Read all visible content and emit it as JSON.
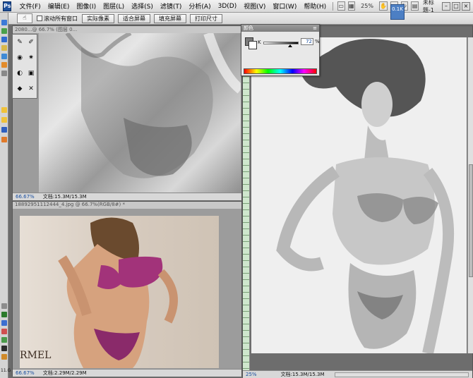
{
  "menubar": {
    "logo": "Ps",
    "items": [
      "文件(F)",
      "编辑(E)",
      "图像(I)",
      "图层(L)",
      "选择(S)",
      "滤镜(T)",
      "分析(A)",
      "3D(D)",
      "视图(V)",
      "窗口(W)",
      "帮助(H)"
    ],
    "zoom": "25%",
    "doc_title": "未标题-1"
  },
  "optbar": {
    "checkbox_label": "滚动所有窗口",
    "buttons": [
      "实际像素",
      "适合屏幕",
      "填充屏幕",
      "打印尺寸"
    ]
  },
  "tiny_overlay": {
    "text": "0.1K"
  },
  "color_panel": {
    "title": "颜色",
    "channel_label": "K",
    "value": "72",
    "unit": "%",
    "fg_color": "#7a7a7a",
    "bg_color": "#ffffff"
  },
  "doc1": {
    "title": "2080...@ 66.7% (图层 0...",
    "zoom": "66.67%",
    "size": "文档:15.3M/15.3M"
  },
  "doc2": {
    "title": "18892951112444_4.jpg @ 66.7%(RGB/8#) *",
    "zoom": "66.67%",
    "size": "文档:2.29M/2.29M",
    "watermark": "RMEL"
  },
  "doc3": {
    "zoom": "25%",
    "size": "文档:15.3M/15.3M"
  },
  "tools_bottom_label": "11.G"
}
